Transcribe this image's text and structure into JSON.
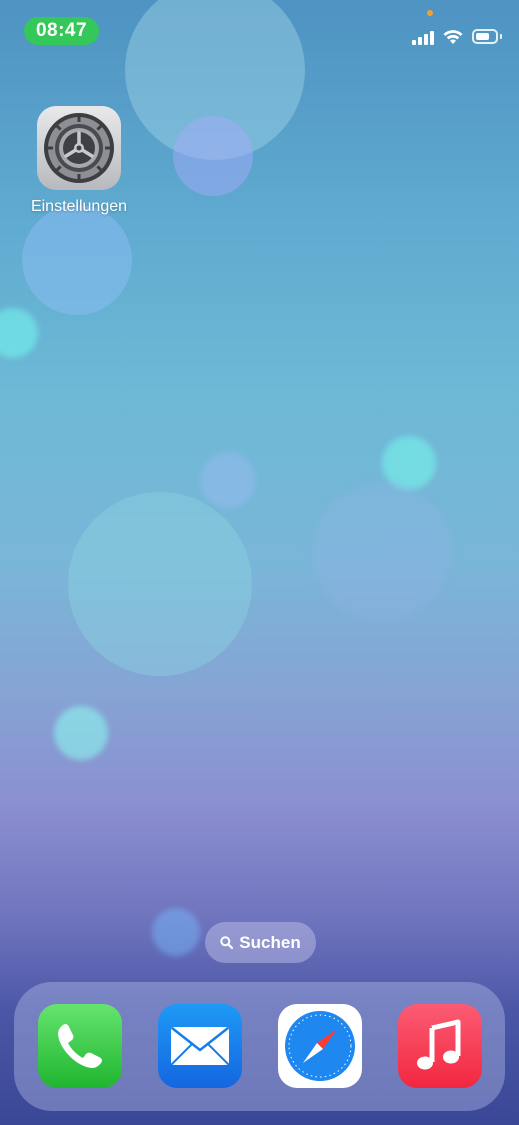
{
  "status_bar": {
    "time": "08:47",
    "time_pill_color": "#34c759",
    "privacy_indicator_color": "#f2a22b",
    "signal_bars": 4,
    "battery_level": 0.7
  },
  "home_screen": {
    "apps": [
      {
        "label": "Einstellungen",
        "icon": "gear-icon"
      }
    ]
  },
  "search": {
    "label": "Suchen",
    "icon": "search-icon"
  },
  "dock": {
    "apps": [
      {
        "icon": "phone-icon",
        "color": "#34c759"
      },
      {
        "icon": "mail-icon",
        "color": "#1a8cf0"
      },
      {
        "icon": "safari-compass-icon",
        "color": "#1e88f0"
      },
      {
        "icon": "music-note-icon",
        "color": "#fa3c53"
      }
    ]
  }
}
